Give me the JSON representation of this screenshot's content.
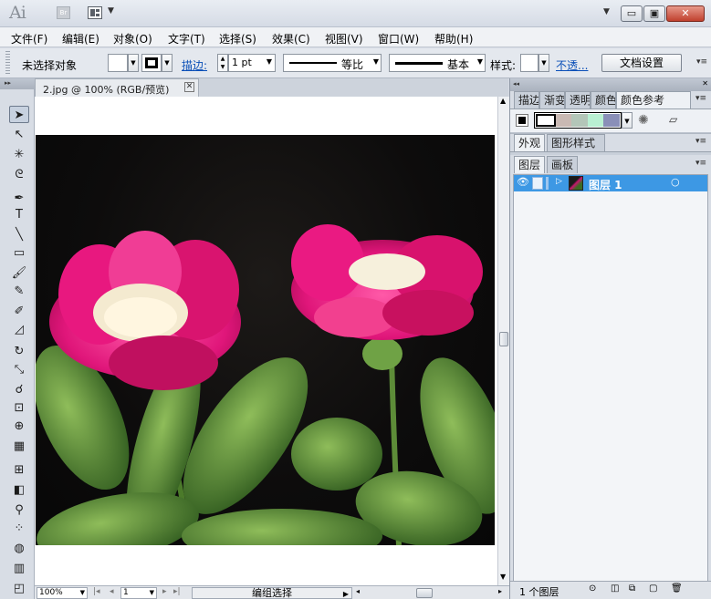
{
  "app": {
    "logo": "Ai",
    "bridge_label": "Br",
    "workspace_caret": "▼"
  },
  "window_controls": {
    "minimize": "▭",
    "maximize": "▣",
    "close": "✕"
  },
  "menu": [
    "文件(F)",
    "编辑(E)",
    "对象(O)",
    "文字(T)",
    "选择(S)",
    "效果(C)",
    "视图(V)",
    "窗口(W)",
    "帮助(H)"
  ],
  "control_bar": {
    "selection_status": "未选择对象",
    "stroke_label": "描边:",
    "stroke_weight": "1 pt",
    "profile_label": "等比",
    "brush_label": "基本",
    "style_label": "样式:",
    "opacity_label": "不透...",
    "doc_setup_button": "文档设置"
  },
  "document": {
    "tab_title": "2.jpg @ 100% (RGB/预览)",
    "close_glyph": "✕"
  },
  "tools": [
    {
      "name": "selection-tool-icon",
      "glyph": "➤",
      "selected": true
    },
    {
      "name": "direct-selection-tool-icon",
      "glyph": "↖",
      "selected": false
    },
    {
      "name": "magic-wand-tool-icon",
      "glyph": "✳",
      "selected": false
    },
    {
      "name": "lasso-tool-icon",
      "glyph": "ᘓ",
      "selected": false
    },
    {
      "name": "pen-tool-icon",
      "glyph": "✒",
      "selected": false
    },
    {
      "name": "type-tool-icon",
      "glyph": "T",
      "selected": false
    },
    {
      "name": "line-tool-icon",
      "glyph": "╲",
      "selected": false
    },
    {
      "name": "rectangle-tool-icon",
      "glyph": "▭",
      "selected": false
    },
    {
      "name": "paintbrush-tool-icon",
      "glyph": "🖌",
      "selected": false
    },
    {
      "name": "pencil-tool-icon",
      "glyph": "✎",
      "selected": false
    },
    {
      "name": "blob-brush-tool-icon",
      "glyph": "✐",
      "selected": false
    },
    {
      "name": "eraser-tool-icon",
      "glyph": "◿",
      "selected": false
    },
    {
      "name": "rotate-tool-icon",
      "glyph": "↻",
      "selected": false
    },
    {
      "name": "scale-tool-icon",
      "glyph": "⤡",
      "selected": false
    },
    {
      "name": "warp-tool-icon",
      "glyph": "☌",
      "selected": false
    },
    {
      "name": "free-transform-tool-icon",
      "glyph": "⊡",
      "selected": false
    },
    {
      "name": "shape-builder-tool-icon",
      "glyph": "⊕",
      "selected": false
    },
    {
      "name": "perspective-grid-tool-icon",
      "glyph": "▦",
      "selected": false
    },
    {
      "name": "mesh-tool-icon",
      "glyph": "⊞",
      "selected": false
    },
    {
      "name": "gradient-tool-icon",
      "glyph": "◧",
      "selected": false
    },
    {
      "name": "eyedropper-tool-icon",
      "glyph": "⚲",
      "selected": false
    },
    {
      "name": "blend-tool-icon",
      "glyph": "⁘",
      "selected": false
    },
    {
      "name": "symbol-sprayer-tool-icon",
      "glyph": "◍",
      "selected": false
    },
    {
      "name": "column-graph-tool-icon",
      "glyph": "▥",
      "selected": false
    },
    {
      "name": "artboard-tool-icon",
      "glyph": "◰",
      "selected": false
    }
  ],
  "status_bar": {
    "zoom": "100%",
    "artboard_index": "1",
    "mode_label": "编组选择",
    "nav_first": "|◂",
    "nav_prev": "◂",
    "nav_next": "▸",
    "nav_last": "▸|",
    "arrow": "▶"
  },
  "panels": {
    "color_tabs": [
      "描边",
      "渐变",
      "透明",
      "颜色",
      "颜色参考"
    ],
    "guide_swatches": [
      "#ffffff",
      "#c9b9b3",
      "#b3c6b8",
      "#b9f0d2",
      "#8a8fb8"
    ],
    "appearance_tabs": [
      "外观",
      "图形样式"
    ],
    "layers_tabs": [
      "图层",
      "画板"
    ],
    "layer_name": "图层 1",
    "layer_count": "1 个图层",
    "layer_color": "#3d98e4"
  }
}
